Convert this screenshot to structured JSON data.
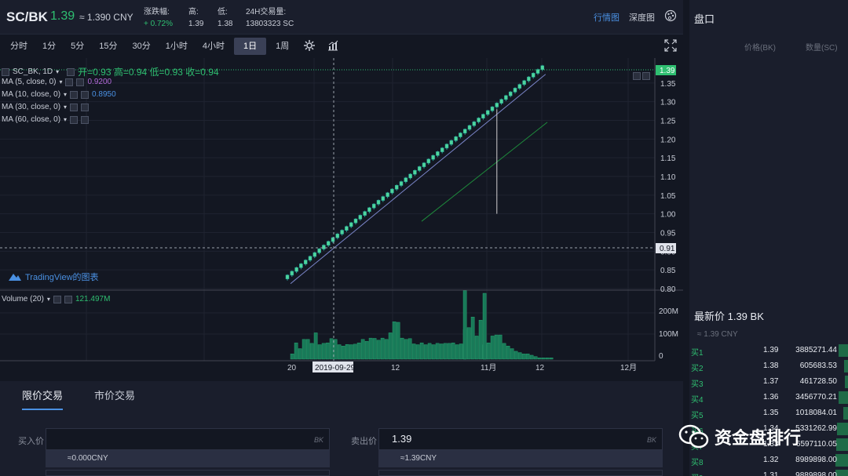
{
  "header": {
    "pair": "SC/BK",
    "price": "1.39",
    "cny": "≈ 1.390 CNY",
    "change_label": "涨跌幅:",
    "change_value": "+ 0.72%",
    "high_label": "高:",
    "high_value": "1.39",
    "low_label": "低:",
    "low_value": "1.38",
    "vol_label": "24H交易量:",
    "vol_value": "13803323 SC",
    "tab_market": "行情图",
    "tab_depth": "深度图"
  },
  "toolbar": {
    "timeframes": [
      "分时",
      "1分",
      "5分",
      "15分",
      "30分",
      "1小时",
      "4小时",
      "1日",
      "1周"
    ],
    "active": "1日"
  },
  "legend": {
    "symbol": "SC_BK, 1D",
    "ohlc": "开=0.93  高=0.94  低=0.93  收=0.94",
    "ma5": "MA (5, close, 0)",
    "ma5_val": "0.9200",
    "ma10": "MA (10, close, 0)",
    "ma10_val": "0.8950",
    "ma30": "MA (30, close, 0)",
    "ma60": "MA (60, close, 0)",
    "volume": "Volume (20)",
    "volume_val": "121.497M",
    "tradingview": "TradingView的图表"
  },
  "axis": {
    "price_ticks": [
      "1.35",
      "1.30",
      "1.25",
      "1.20",
      "1.15",
      "1.10",
      "1.05",
      "1.00",
      "0.95",
      "0.90",
      "0.85",
      "0.80"
    ],
    "current_price_tag": "1.39",
    "crosshair_price_tag": "0.91",
    "vol_ticks": [
      "200M",
      "100M",
      "0"
    ],
    "x_ticks": [
      "20",
      "12",
      "11月",
      "12",
      "12月"
    ],
    "crosshair_date": "2019-09-29"
  },
  "chart_data": {
    "type": "candlestick",
    "price_range": [
      0.8,
      1.4
    ],
    "volume_range": [
      0,
      250
    ],
    "candles": [
      0.83,
      0.84,
      0.85,
      0.86,
      0.87,
      0.88,
      0.89,
      0.9,
      0.91,
      0.92,
      0.93,
      0.94,
      0.95,
      0.96,
      0.97,
      0.98,
      0.99,
      1.0,
      1.01,
      1.02,
      1.03,
      1.04,
      1.05,
      1.06,
      1.07,
      1.08,
      1.09,
      1.1,
      1.11,
      1.12,
      1.13,
      1.14,
      1.15,
      1.16,
      1.17,
      1.18,
      1.19,
      1.2,
      1.21,
      1.22,
      1.23,
      1.24,
      1.25,
      1.26,
      1.27,
      1.28,
      1.29,
      1.3,
      1.31,
      1.32,
      1.33,
      1.34,
      1.35,
      1.36,
      1.37,
      1.38,
      1.39
    ],
    "volumes": [
      20,
      62,
      40,
      75,
      75,
      60,
      100,
      55,
      60,
      62,
      78,
      75,
      55,
      50,
      56,
      55,
      57,
      62,
      75,
      68,
      80,
      79,
      72,
      80,
      75,
      100,
      142,
      140,
      80,
      75,
      78,
      58,
      55,
      62,
      55,
      60,
      55,
      60,
      58,
      60,
      60,
      62,
      55,
      58,
      112,
      120,
      160,
      88,
      148,
      55,
      62,
      88,
      92,
      92,
      60,
      50,
      40,
      30,
      25,
      20,
      20,
      15,
      10,
      5,
      5,
      5,
      5
    ],
    "volume_spikes": {
      "index_a": 44,
      "value_a": 260,
      "index_b": 49,
      "value_b": 250
    },
    "ma_lines": [
      {
        "name": "MA (5, close, 0)",
        "color": "#7a85c8"
      },
      {
        "name": "MA (30, close, 0)",
        "color": "#1e8a3c"
      }
    ]
  },
  "trade": {
    "tab_limit": "限价交易",
    "tab_market": "市价交易",
    "buy_label": "买入价",
    "buy_value": "",
    "buy_unit": "BK",
    "buy_conv": "≈0.000CNY",
    "sell_label": "卖出价",
    "sell_value": "1.39",
    "sell_unit": "BK",
    "sell_conv": "≈1.39CNY"
  },
  "book": {
    "title": "盘口",
    "col_price": "价格(BK)",
    "col_qty": "数量(SC)",
    "last_price": "最新价 1.39 BK",
    "last_cny": "≈ 1.39 CNY",
    "bids": [
      {
        "label": "买1",
        "price": "1.39",
        "qty": "3885271.44",
        "depth": 12
      },
      {
        "label": "买2",
        "price": "1.38",
        "qty": "605683.53",
        "depth": 5
      },
      {
        "label": "买3",
        "price": "1.37",
        "qty": "461728.50",
        "depth": 4
      },
      {
        "label": "买4",
        "price": "1.36",
        "qty": "3456770.21",
        "depth": 12
      },
      {
        "label": "买5",
        "price": "1.35",
        "qty": "1018084.01",
        "depth": 6
      },
      {
        "label": "买6",
        "price": "1.34",
        "qty": "5331262.99",
        "depth": 14
      },
      {
        "label": "买7",
        "price": "1.33",
        "qty": "6597110.05",
        "depth": 15
      },
      {
        "label": "买8",
        "price": "1.32",
        "qty": "8989898.00",
        "depth": 16
      },
      {
        "label": "买9",
        "price": "1.31",
        "qty": "9889898.00",
        "depth": 16
      }
    ]
  },
  "watermark": "资金盘排行"
}
